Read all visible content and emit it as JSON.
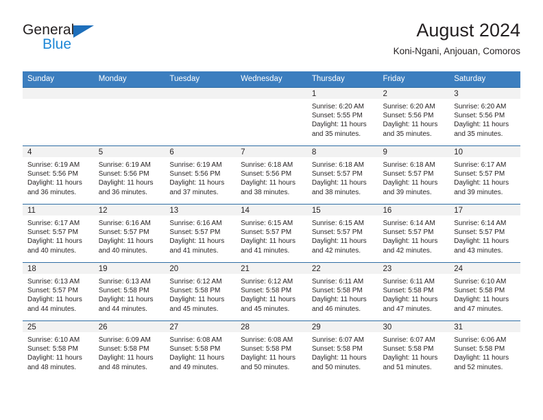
{
  "brand": {
    "name_part1": "General",
    "name_part2": "Blue",
    "triangle_icon": "triangle-icon",
    "colors": {
      "dark": "#231f20",
      "blue": "#1e87d6",
      "triangle": "#1e6fbb"
    }
  },
  "header": {
    "title": "August 2024",
    "subtitle": "Koni-Ngani, Anjouan, Comoros"
  },
  "colors": {
    "header_bg": "#3c7ebf",
    "header_text": "#ffffff",
    "row_divider": "#2e6da4",
    "daynum_band": "#f2f2f2",
    "text": "#231f20"
  },
  "weekday_headers": [
    "Sunday",
    "Monday",
    "Tuesday",
    "Wednesday",
    "Thursday",
    "Friday",
    "Saturday"
  ],
  "weeks": [
    [
      {
        "day": "",
        "lines": []
      },
      {
        "day": "",
        "lines": []
      },
      {
        "day": "",
        "lines": []
      },
      {
        "day": "",
        "lines": []
      },
      {
        "day": "1",
        "lines": [
          "Sunrise: 6:20 AM",
          "Sunset: 5:55 PM",
          "Daylight: 11 hours",
          "and 35 minutes."
        ]
      },
      {
        "day": "2",
        "lines": [
          "Sunrise: 6:20 AM",
          "Sunset: 5:56 PM",
          "Daylight: 11 hours",
          "and 35 minutes."
        ]
      },
      {
        "day": "3",
        "lines": [
          "Sunrise: 6:20 AM",
          "Sunset: 5:56 PM",
          "Daylight: 11 hours",
          "and 35 minutes."
        ]
      }
    ],
    [
      {
        "day": "4",
        "lines": [
          "Sunrise: 6:19 AM",
          "Sunset: 5:56 PM",
          "Daylight: 11 hours",
          "and 36 minutes."
        ]
      },
      {
        "day": "5",
        "lines": [
          "Sunrise: 6:19 AM",
          "Sunset: 5:56 PM",
          "Daylight: 11 hours",
          "and 36 minutes."
        ]
      },
      {
        "day": "6",
        "lines": [
          "Sunrise: 6:19 AM",
          "Sunset: 5:56 PM",
          "Daylight: 11 hours",
          "and 37 minutes."
        ]
      },
      {
        "day": "7",
        "lines": [
          "Sunrise: 6:18 AM",
          "Sunset: 5:56 PM",
          "Daylight: 11 hours",
          "and 38 minutes."
        ]
      },
      {
        "day": "8",
        "lines": [
          "Sunrise: 6:18 AM",
          "Sunset: 5:57 PM",
          "Daylight: 11 hours",
          "and 38 minutes."
        ]
      },
      {
        "day": "9",
        "lines": [
          "Sunrise: 6:18 AM",
          "Sunset: 5:57 PM",
          "Daylight: 11 hours",
          "and 39 minutes."
        ]
      },
      {
        "day": "10",
        "lines": [
          "Sunrise: 6:17 AM",
          "Sunset: 5:57 PM",
          "Daylight: 11 hours",
          "and 39 minutes."
        ]
      }
    ],
    [
      {
        "day": "11",
        "lines": [
          "Sunrise: 6:17 AM",
          "Sunset: 5:57 PM",
          "Daylight: 11 hours",
          "and 40 minutes."
        ]
      },
      {
        "day": "12",
        "lines": [
          "Sunrise: 6:16 AM",
          "Sunset: 5:57 PM",
          "Daylight: 11 hours",
          "and 40 minutes."
        ]
      },
      {
        "day": "13",
        "lines": [
          "Sunrise: 6:16 AM",
          "Sunset: 5:57 PM",
          "Daylight: 11 hours",
          "and 41 minutes."
        ]
      },
      {
        "day": "14",
        "lines": [
          "Sunrise: 6:15 AM",
          "Sunset: 5:57 PM",
          "Daylight: 11 hours",
          "and 41 minutes."
        ]
      },
      {
        "day": "15",
        "lines": [
          "Sunrise: 6:15 AM",
          "Sunset: 5:57 PM",
          "Daylight: 11 hours",
          "and 42 minutes."
        ]
      },
      {
        "day": "16",
        "lines": [
          "Sunrise: 6:14 AM",
          "Sunset: 5:57 PM",
          "Daylight: 11 hours",
          "and 42 minutes."
        ]
      },
      {
        "day": "17",
        "lines": [
          "Sunrise: 6:14 AM",
          "Sunset: 5:57 PM",
          "Daylight: 11 hours",
          "and 43 minutes."
        ]
      }
    ],
    [
      {
        "day": "18",
        "lines": [
          "Sunrise: 6:13 AM",
          "Sunset: 5:57 PM",
          "Daylight: 11 hours",
          "and 44 minutes."
        ]
      },
      {
        "day": "19",
        "lines": [
          "Sunrise: 6:13 AM",
          "Sunset: 5:58 PM",
          "Daylight: 11 hours",
          "and 44 minutes."
        ]
      },
      {
        "day": "20",
        "lines": [
          "Sunrise: 6:12 AM",
          "Sunset: 5:58 PM",
          "Daylight: 11 hours",
          "and 45 minutes."
        ]
      },
      {
        "day": "21",
        "lines": [
          "Sunrise: 6:12 AM",
          "Sunset: 5:58 PM",
          "Daylight: 11 hours",
          "and 45 minutes."
        ]
      },
      {
        "day": "22",
        "lines": [
          "Sunrise: 6:11 AM",
          "Sunset: 5:58 PM",
          "Daylight: 11 hours",
          "and 46 minutes."
        ]
      },
      {
        "day": "23",
        "lines": [
          "Sunrise: 6:11 AM",
          "Sunset: 5:58 PM",
          "Daylight: 11 hours",
          "and 47 minutes."
        ]
      },
      {
        "day": "24",
        "lines": [
          "Sunrise: 6:10 AM",
          "Sunset: 5:58 PM",
          "Daylight: 11 hours",
          "and 47 minutes."
        ]
      }
    ],
    [
      {
        "day": "25",
        "lines": [
          "Sunrise: 6:10 AM",
          "Sunset: 5:58 PM",
          "Daylight: 11 hours",
          "and 48 minutes."
        ]
      },
      {
        "day": "26",
        "lines": [
          "Sunrise: 6:09 AM",
          "Sunset: 5:58 PM",
          "Daylight: 11 hours",
          "and 48 minutes."
        ]
      },
      {
        "day": "27",
        "lines": [
          "Sunrise: 6:08 AM",
          "Sunset: 5:58 PM",
          "Daylight: 11 hours",
          "and 49 minutes."
        ]
      },
      {
        "day": "28",
        "lines": [
          "Sunrise: 6:08 AM",
          "Sunset: 5:58 PM",
          "Daylight: 11 hours",
          "and 50 minutes."
        ]
      },
      {
        "day": "29",
        "lines": [
          "Sunrise: 6:07 AM",
          "Sunset: 5:58 PM",
          "Daylight: 11 hours",
          "and 50 minutes."
        ]
      },
      {
        "day": "30",
        "lines": [
          "Sunrise: 6:07 AM",
          "Sunset: 5:58 PM",
          "Daylight: 11 hours",
          "and 51 minutes."
        ]
      },
      {
        "day": "31",
        "lines": [
          "Sunrise: 6:06 AM",
          "Sunset: 5:58 PM",
          "Daylight: 11 hours",
          "and 52 minutes."
        ]
      }
    ]
  ]
}
